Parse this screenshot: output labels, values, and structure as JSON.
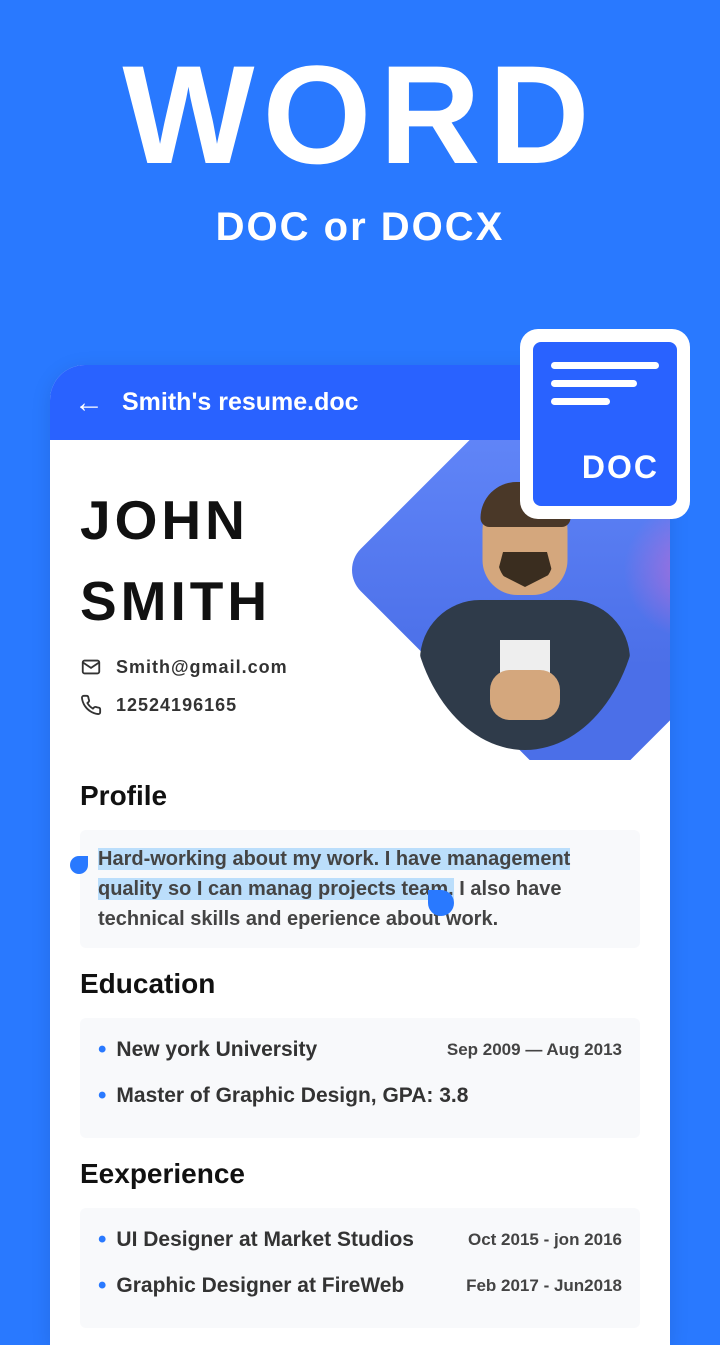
{
  "hero": {
    "title": "WORD",
    "subtitle": "DOC or DOCX"
  },
  "badge": {
    "label": "DOC"
  },
  "header": {
    "filename": "Smith's resume.doc"
  },
  "resume": {
    "first_name": "JOHN",
    "last_name": "SMITH",
    "email": "Smith@gmail.com",
    "phone": "12524196165",
    "profile_title": "Profile",
    "profile_highlighted": "Hard-working about my work. I have management quality so I can manag projects team.",
    "profile_rest": " I also have technical skills and eperience about work.",
    "education_title": "Education",
    "education": [
      {
        "text": "New york University",
        "date": "Sep 2009 — Aug 2013"
      },
      {
        "text": "Master of Graphic Design,    GPA:   3.8",
        "date": ""
      }
    ],
    "experience_title": "Eexperience",
    "experience": [
      {
        "text": "UI Designer at Market Studios",
        "date": "Oct 2015 - jon 2016"
      },
      {
        "text": "Graphic Designer at FireWeb",
        "date": "Feb 2017 - Jun2018"
      }
    ]
  }
}
